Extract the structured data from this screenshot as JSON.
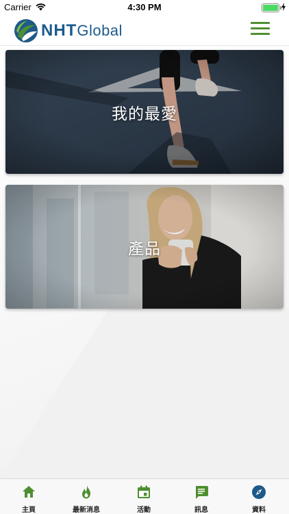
{
  "status_bar": {
    "carrier": "Carrier",
    "time": "4:30 PM"
  },
  "header": {
    "logo_primary": "NHT",
    "logo_secondary": "Global",
    "menu_icon": "hamburger-menu-icon",
    "accent_color": "#4d8f2f",
    "brand_color": "#1d5a8a"
  },
  "cards": [
    {
      "label": "我的最愛",
      "image": "runner-legs-photo"
    },
    {
      "label": "產品",
      "image": "woman-holding-cup-photo"
    }
  ],
  "tabbar": {
    "items": [
      {
        "label": "主頁",
        "icon": "home-icon"
      },
      {
        "label": "最新消息",
        "icon": "flame-icon"
      },
      {
        "label": "活動",
        "icon": "calendar-icon"
      },
      {
        "label": "訊息",
        "icon": "chat-icon"
      },
      {
        "label": "資料",
        "icon": "compass-icon"
      }
    ]
  }
}
